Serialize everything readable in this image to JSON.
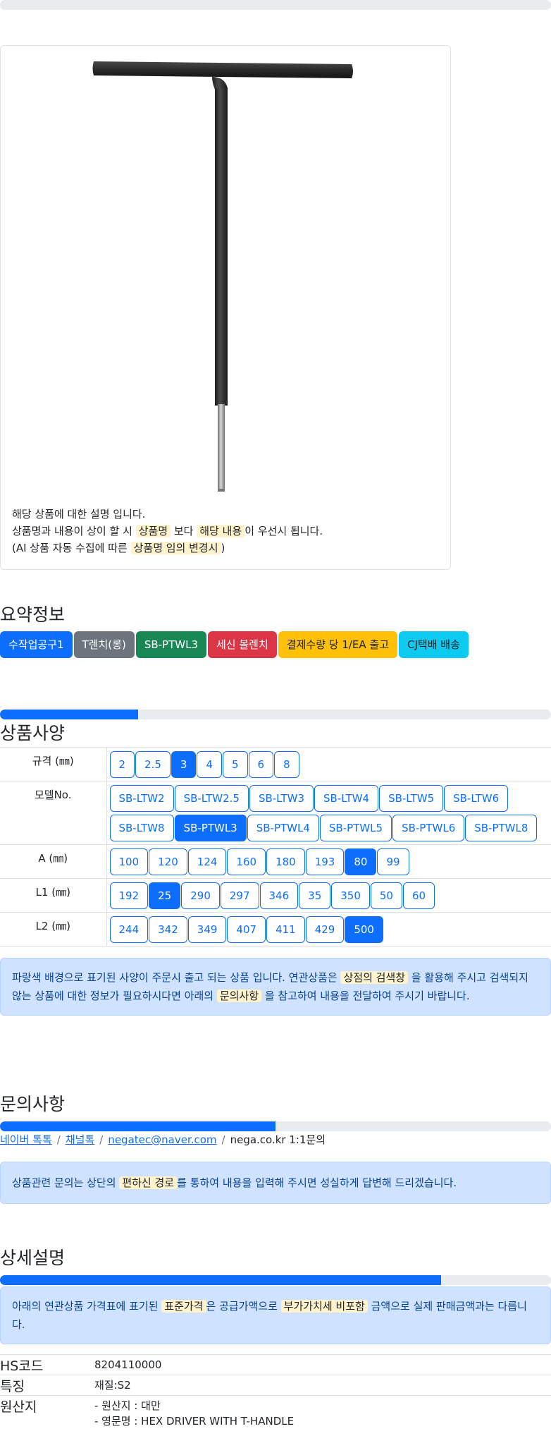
{
  "product_card": {
    "image_alt": "T-handle hex driver",
    "desc_line1": "해당 상품에 대한 설명 입니다.",
    "desc_line2_a": "상품명과 내용이 상이 할 시",
    "desc_line2_m1": "상품명",
    "desc_line2_b": "보다",
    "desc_line2_m2": "해당 내용",
    "desc_line2_c": "이 우선시 됩니다.",
    "desc_line3_a": "(AI 상품 자동 수집에 따른",
    "desc_line3_m": "상품명 임의 변경시",
    "desc_line3_b": ")"
  },
  "summary": {
    "title": "요약정보",
    "badges": [
      {
        "label": "수작업공구1",
        "color": "#0d6efd",
        "text_color": "#ffffff"
      },
      {
        "label": "T렌치(롱)",
        "color": "#6c757d",
        "text_color": "#ffffff"
      },
      {
        "label": "SB-PTWL3",
        "color": "#198754",
        "text_color": "#ffffff"
      },
      {
        "label": "세신 볼렌치",
        "color": "#dc3545",
        "text_color": "#ffffff"
      },
      {
        "label": "결제수량 당 1/EA 출고",
        "color": "#ffc107",
        "text_color": "#212529"
      },
      {
        "label": "CJ택배 배송",
        "color": "#0dcaf0",
        "text_color": "#212529"
      }
    ]
  },
  "spec": {
    "title": "상품사양",
    "progress": 0.25,
    "rows": [
      {
        "label": "규격 (㎜)",
        "options": [
          "2",
          "2.5",
          "3",
          "4",
          "5",
          "6",
          "8"
        ],
        "selected": "3"
      },
      {
        "label": "모델No.",
        "options": [
          "SB-LTW2",
          "SB-LTW2.5",
          "SB-LTW3",
          "SB-LTW4",
          "SB-LTW5",
          "SB-LTW6",
          "SB-LTW8",
          "SB-PTWL3",
          "SB-PTWL4",
          "SB-PTWL5",
          "SB-PTWL6",
          "SB-PTWL8"
        ],
        "selected": "SB-PTWL3"
      },
      {
        "label": "A (㎜)",
        "options": [
          "100",
          "120",
          "124",
          "160",
          "180",
          "193",
          "80",
          "99"
        ],
        "selected": "80"
      },
      {
        "label": "L1 (㎜)",
        "options": [
          "192",
          "25",
          "290",
          "297",
          "346",
          "35",
          "350",
          "50",
          "60"
        ],
        "selected": "25"
      },
      {
        "label": "L2 (㎜)",
        "options": [
          "244",
          "342",
          "349",
          "407",
          "411",
          "429",
          "500"
        ],
        "selected": "500"
      }
    ],
    "notice_a": "파랑색 배경으로 표기된 사양이 주문시 출고 되는 상품 입니다. 연관상품은",
    "notice_m1": "상점의 검색창",
    "notice_b": "을 활용해 주시고 검색되지 않는 상품에 대한 정보가 필요하시다면 아래의",
    "notice_m2": "문의사항",
    "notice_c": "을 참고하여 내용을 전달하여 주시기 바랍니다."
  },
  "inquiry": {
    "title": "문의사항",
    "progress": 0.5,
    "links": [
      "네이버 톡톡",
      "채널톡",
      "negatec@naver.com"
    ],
    "last_crumb": "nega.co.kr 1:1문의",
    "notice_a": "상품관련 문의는 상단의",
    "notice_m": "편하신 경로",
    "notice_b": "를 통하여 내용을 입력해 주시면 성실하게 답변해 드리겠습니다."
  },
  "detail": {
    "title": "상세설명",
    "progress": 0.8,
    "notice_a": "아래의 연관상품 가격표에 표기된",
    "notice_m1": "표준가격",
    "notice_b": "은 공급가액으로",
    "notice_m2": "부가가치세 비포함",
    "notice_c": "금액으로 실제 판매금액과는 다릅니다.",
    "info": [
      {
        "key": "HS코드",
        "lines": [
          "8204110000"
        ]
      },
      {
        "key": "특징",
        "lines": [
          "재질:S2"
        ]
      },
      {
        "key": "원산지",
        "lines": [
          "- 원산지 : 대만",
          "- 영문명 : HEX DRIVER WITH T-HANDLE"
        ]
      }
    ]
  }
}
